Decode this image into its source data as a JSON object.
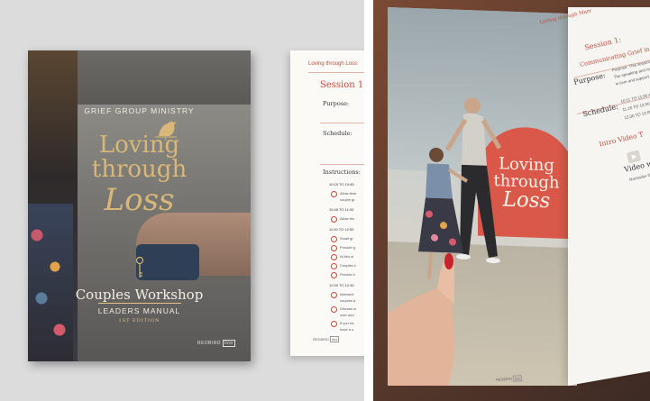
{
  "left_mockup": {
    "cover": {
      "ministry": "GRIEF GROUP MINISTRY",
      "title_line1": "Loving",
      "title_line2": "through",
      "title_script": "Loss",
      "subtitle": "Couples Workshop",
      "manual": "LEADERS MANUAL",
      "edition": "1ST EDITION",
      "brand": "REDBIRD",
      "brand_tag": "lino"
    },
    "inner_page": {
      "header": "Loving through Loss",
      "session": "Session 1: C",
      "purpose_label": "Purpose:",
      "schedule_label": "Schedule:",
      "instructions_label": "Instructions:",
      "times": [
        "10:15 TO 10:45",
        "10:45 TO 11:00",
        "11:00 TO 12:00",
        "12:00 TO 12:30"
      ],
      "items": [
        "Allow time",
        "couple gr",
        "Allow tim",
        "Small gr",
        "Provide g",
        "At this si",
        "Couples s",
        "Provide b",
        "Intersect",
        "couples a",
        "Discuss w",
        "over and",
        "If you ha",
        "have a s"
      ],
      "brand": "REDBIRD",
      "brand_tag": "lino"
    }
  },
  "right_photo": {
    "photo_title_line1": "Loving",
    "photo_title_line2": "through",
    "photo_title_script": "Loss",
    "page": {
      "header": "Loving through Marr",
      "session": "Session 1:",
      "session_subtitle": "Communicating Grief in Marr",
      "purpose_label": "Purpose:",
      "purpose_text": [
        "Purpose: This session focuses on",
        "The speaking and reflecting exe",
        "in love and support each other"
      ],
      "schedule_label": "Schedule:",
      "schedule_times": [
        "10:11 TO 11:00 AM",
        "11:15 TO 12:00 PM",
        "12:30 TO 12:00 PM"
      ],
      "intro_video": "Intro Video T",
      "video_with": "Video wi",
      "video_small": "Reminder if y",
      "brand": "REDBIRD",
      "brand_tag": "lino"
    }
  },
  "colors": {
    "accent_red": "#c44a3e",
    "gold": "#d9b778",
    "arch_coral": "#d9584a"
  }
}
